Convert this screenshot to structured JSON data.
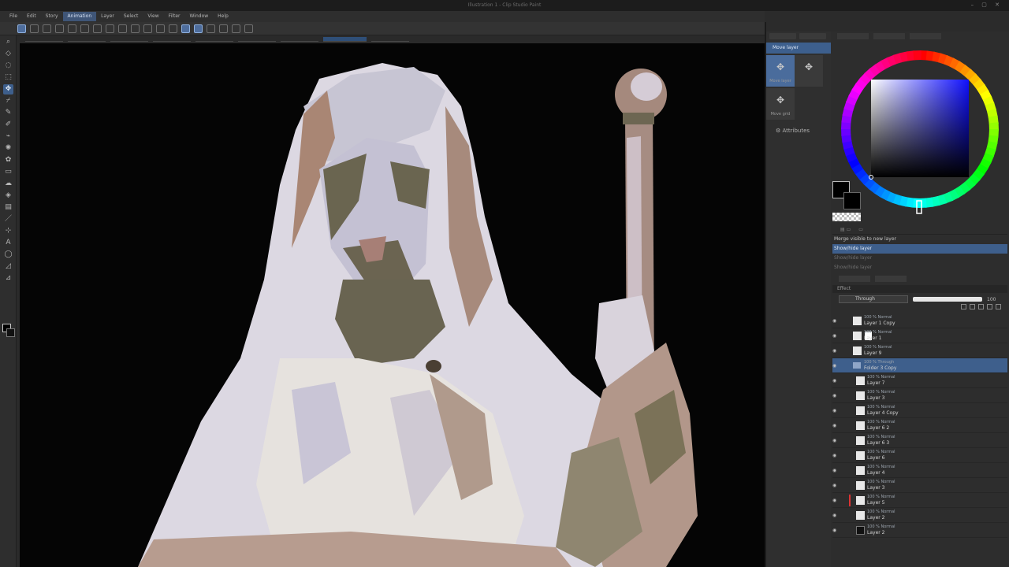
{
  "window": {
    "title": "Illustration 1 - Clip Studio Paint",
    "controls": "– ▢ ✕"
  },
  "menu": [
    "File",
    "Edit",
    "Story",
    "Animation",
    "Layer",
    "Select",
    "View",
    "Filter",
    "Window",
    "Help"
  ],
  "menu_active_index": 3,
  "subtool_panel": {
    "header": "Move layer",
    "tiles": [
      {
        "icon": "move-icon",
        "caption": "Move layer"
      },
      {
        "icon": "move-icon",
        "caption": ""
      },
      {
        "icon": "move-icon",
        "caption": "Move grid"
      }
    ],
    "attributes_label": "Attributes"
  },
  "color": {
    "main": "#000000",
    "sub": "#000000",
    "accent": "#3e5f8c"
  },
  "history": {
    "items": [
      {
        "label": "Merge visible to new layer",
        "state": "normal"
      },
      {
        "label": "Show/hide layer",
        "state": "selected"
      },
      {
        "label": "Show/hide layer",
        "state": "dim"
      },
      {
        "label": "Show/hide layer",
        "state": "dim"
      }
    ]
  },
  "layers": {
    "search": "Effect",
    "blend_mode": "Through",
    "opacity": "100",
    "rows": [
      {
        "mode": "100 % Normal",
        "name": "Layer 1 Copy",
        "thumb": "light",
        "indent": false,
        "clip": false,
        "mask": false,
        "sel": false
      },
      {
        "mode": "100 % Normal",
        "name": "Layer 1",
        "thumb": "light",
        "indent": false,
        "clip": false,
        "mask": true,
        "sel": false
      },
      {
        "mode": "100 % Normal",
        "name": "Layer 9",
        "thumb": "light",
        "indent": false,
        "clip": false,
        "mask": false,
        "sel": false
      },
      {
        "mode": "100 % Through",
        "name": "Folder 3 Copy",
        "thumb": "folder",
        "indent": false,
        "clip": false,
        "mask": false,
        "sel": true
      },
      {
        "mode": "100 % Normal",
        "name": "Layer 7",
        "thumb": "light",
        "indent": true,
        "clip": false,
        "mask": false,
        "sel": false
      },
      {
        "mode": "100 % Normal",
        "name": "Layer 3",
        "thumb": "light",
        "indent": true,
        "clip": false,
        "mask": false,
        "sel": false
      },
      {
        "mode": "100 % Normal",
        "name": "Layer 4 Copy",
        "thumb": "light",
        "indent": true,
        "clip": false,
        "mask": false,
        "sel": false
      },
      {
        "mode": "100 % Normal",
        "name": "Layer 6 2",
        "thumb": "light",
        "indent": true,
        "clip": false,
        "mask": false,
        "sel": false
      },
      {
        "mode": "100 % Normal",
        "name": "Layer 6 3",
        "thumb": "light",
        "indent": true,
        "clip": false,
        "mask": false,
        "sel": false
      },
      {
        "mode": "100 % Normal",
        "name": "Layer 6",
        "thumb": "light",
        "indent": true,
        "clip": false,
        "mask": false,
        "sel": false
      },
      {
        "mode": "100 % Normal",
        "name": "Layer 4",
        "thumb": "light",
        "indent": true,
        "clip": false,
        "mask": false,
        "sel": false
      },
      {
        "mode": "100 % Normal",
        "name": "Layer 3",
        "thumb": "light",
        "indent": true,
        "clip": false,
        "mask": false,
        "sel": false
      },
      {
        "mode": "100 % Normal",
        "name": "Layer 5",
        "thumb": "light",
        "indent": true,
        "clip": true,
        "mask": false,
        "sel": false
      },
      {
        "mode": "100 % Normal",
        "name": "Layer 2",
        "thumb": "light",
        "indent": true,
        "clip": false,
        "mask": false,
        "sel": false
      },
      {
        "mode": "100 % Normal",
        "name": "Layer 2",
        "thumb": "dark",
        "indent": true,
        "clip": false,
        "mask": false,
        "sel": false
      }
    ]
  }
}
